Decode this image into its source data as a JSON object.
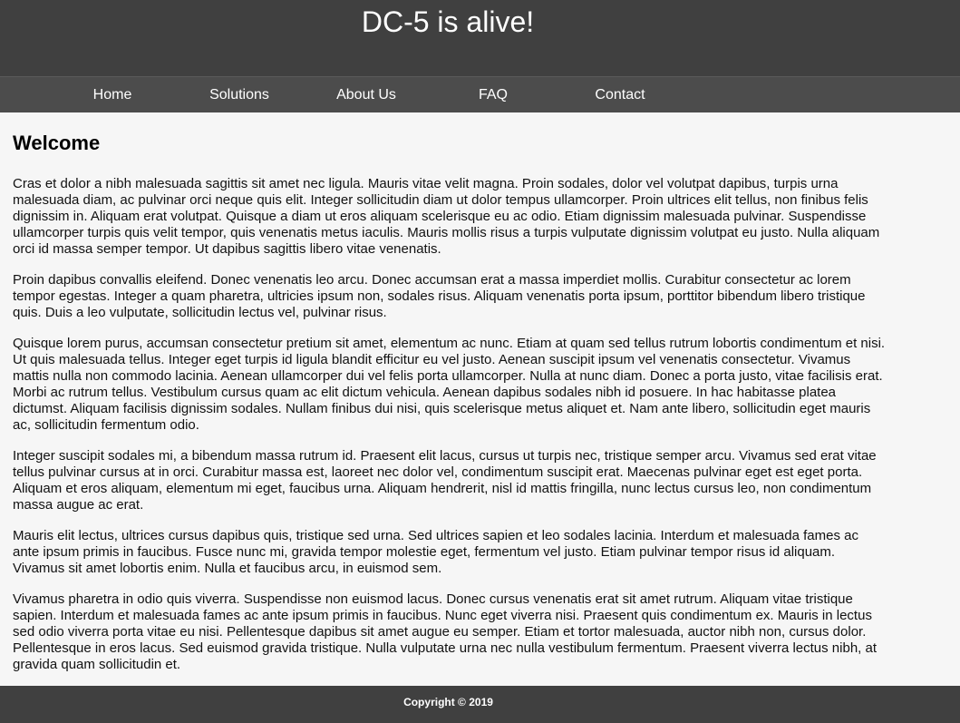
{
  "header": {
    "title": "DC-5 is alive!"
  },
  "nav": {
    "items": [
      {
        "label": "Home"
      },
      {
        "label": "Solutions"
      },
      {
        "label": "About Us"
      },
      {
        "label": "FAQ"
      },
      {
        "label": "Contact"
      }
    ]
  },
  "main": {
    "heading": "Welcome",
    "paragraphs": [
      "Cras et dolor a nibh malesuada sagittis sit amet nec ligula. Mauris vitae velit magna. Proin sodales, dolor vel volutpat dapibus, turpis urna malesuada diam, ac pulvinar orci neque quis elit. Integer sollicitudin diam ut dolor tempus ullamcorper. Proin ultrices elit tellus, non finibus felis dignissim in. Aliquam erat volutpat. Quisque a diam ut eros aliquam scelerisque eu ac odio. Etiam dignissim malesuada pulvinar. Suspendisse ullamcorper turpis quis velit tempor, quis venenatis metus iaculis. Mauris mollis risus a turpis vulputate dignissim volutpat eu justo. Nulla aliquam orci id massa semper tempor. Ut dapibus sagittis libero vitae venenatis.",
      "Proin dapibus convallis eleifend. Donec venenatis leo arcu. Donec accumsan erat a massa imperdiet mollis. Curabitur consectetur ac lorem tempor egestas. Integer a quam pharetra, ultricies ipsum non, sodales risus. Aliquam venenatis porta ipsum, porttitor bibendum libero tristique quis. Duis a leo vulputate, sollicitudin lectus vel, pulvinar risus.",
      "Quisque lorem purus, accumsan consectetur pretium sit amet, elementum ac nunc. Etiam at quam sed tellus rutrum lobortis condimentum et nisi. Ut quis malesuada tellus. Integer eget turpis id ligula blandit efficitur eu vel justo. Aenean suscipit ipsum vel venenatis consectetur. Vivamus mattis nulla non commodo lacinia. Aenean ullamcorper dui vel felis porta ullamcorper. Nulla at nunc diam. Donec a porta justo, vitae facilisis erat. Morbi ac rutrum tellus. Vestibulum cursus quam ac elit dictum vehicula. Aenean dapibus sodales nibh id posuere. In hac habitasse platea dictumst. Aliquam facilisis dignissim sodales. Nullam finibus dui nisi, quis scelerisque metus aliquet et. Nam ante libero, sollicitudin eget mauris ac, sollicitudin fermentum odio.",
      "Integer suscipit sodales mi, a bibendum massa rutrum id. Praesent elit lacus, cursus ut turpis nec, tristique semper arcu. Vivamus sed erat vitae tellus pulvinar cursus at in orci. Curabitur massa est, laoreet nec dolor vel, condimentum suscipit erat. Maecenas pulvinar eget est eget porta. Aliquam et eros aliquam, elementum mi eget, faucibus urna. Aliquam hendrerit, nisl id mattis fringilla, nunc lectus cursus leo, non condimentum massa augue ac erat.",
      "Mauris elit lectus, ultrices cursus dapibus quis, tristique sed urna. Sed ultrices sapien et leo sodales lacinia. Interdum et malesuada fames ac ante ipsum primis in faucibus. Fusce nunc mi, gravida tempor molestie eget, fermentum vel justo. Etiam pulvinar tempor risus id aliquam. Vivamus sit amet lobortis enim. Nulla et faucibus arcu, in euismod sem.",
      "Vivamus pharetra in odio quis viverra. Suspendisse non euismod lacus. Donec cursus venenatis erat sit amet rutrum. Aliquam vitae tristique sapien. Interdum et malesuada fames ac ante ipsum primis in faucibus. Nunc eget viverra nisi. Praesent quis condimentum ex. Mauris in lectus sed odio viverra porta vitae eu nisi. Pellentesque dapibus sit amet augue eu semper. Etiam et tortor malesuada, auctor nibh non, cursus dolor. Pellentesque in eros lacus. Sed euismod gravida tristique. Nulla vulputate urna nec nulla vestibulum fermentum. Praesent viverra lectus nibh, at gravida quam sollicitudin et."
    ]
  },
  "footer": {
    "copyright": "Copyright © 2019"
  },
  "colors": {
    "header_bg": "#404040",
    "nav_bg": "#4c4c4c",
    "page_bg": "#f6f6f6",
    "footer_bg": "#404040"
  }
}
